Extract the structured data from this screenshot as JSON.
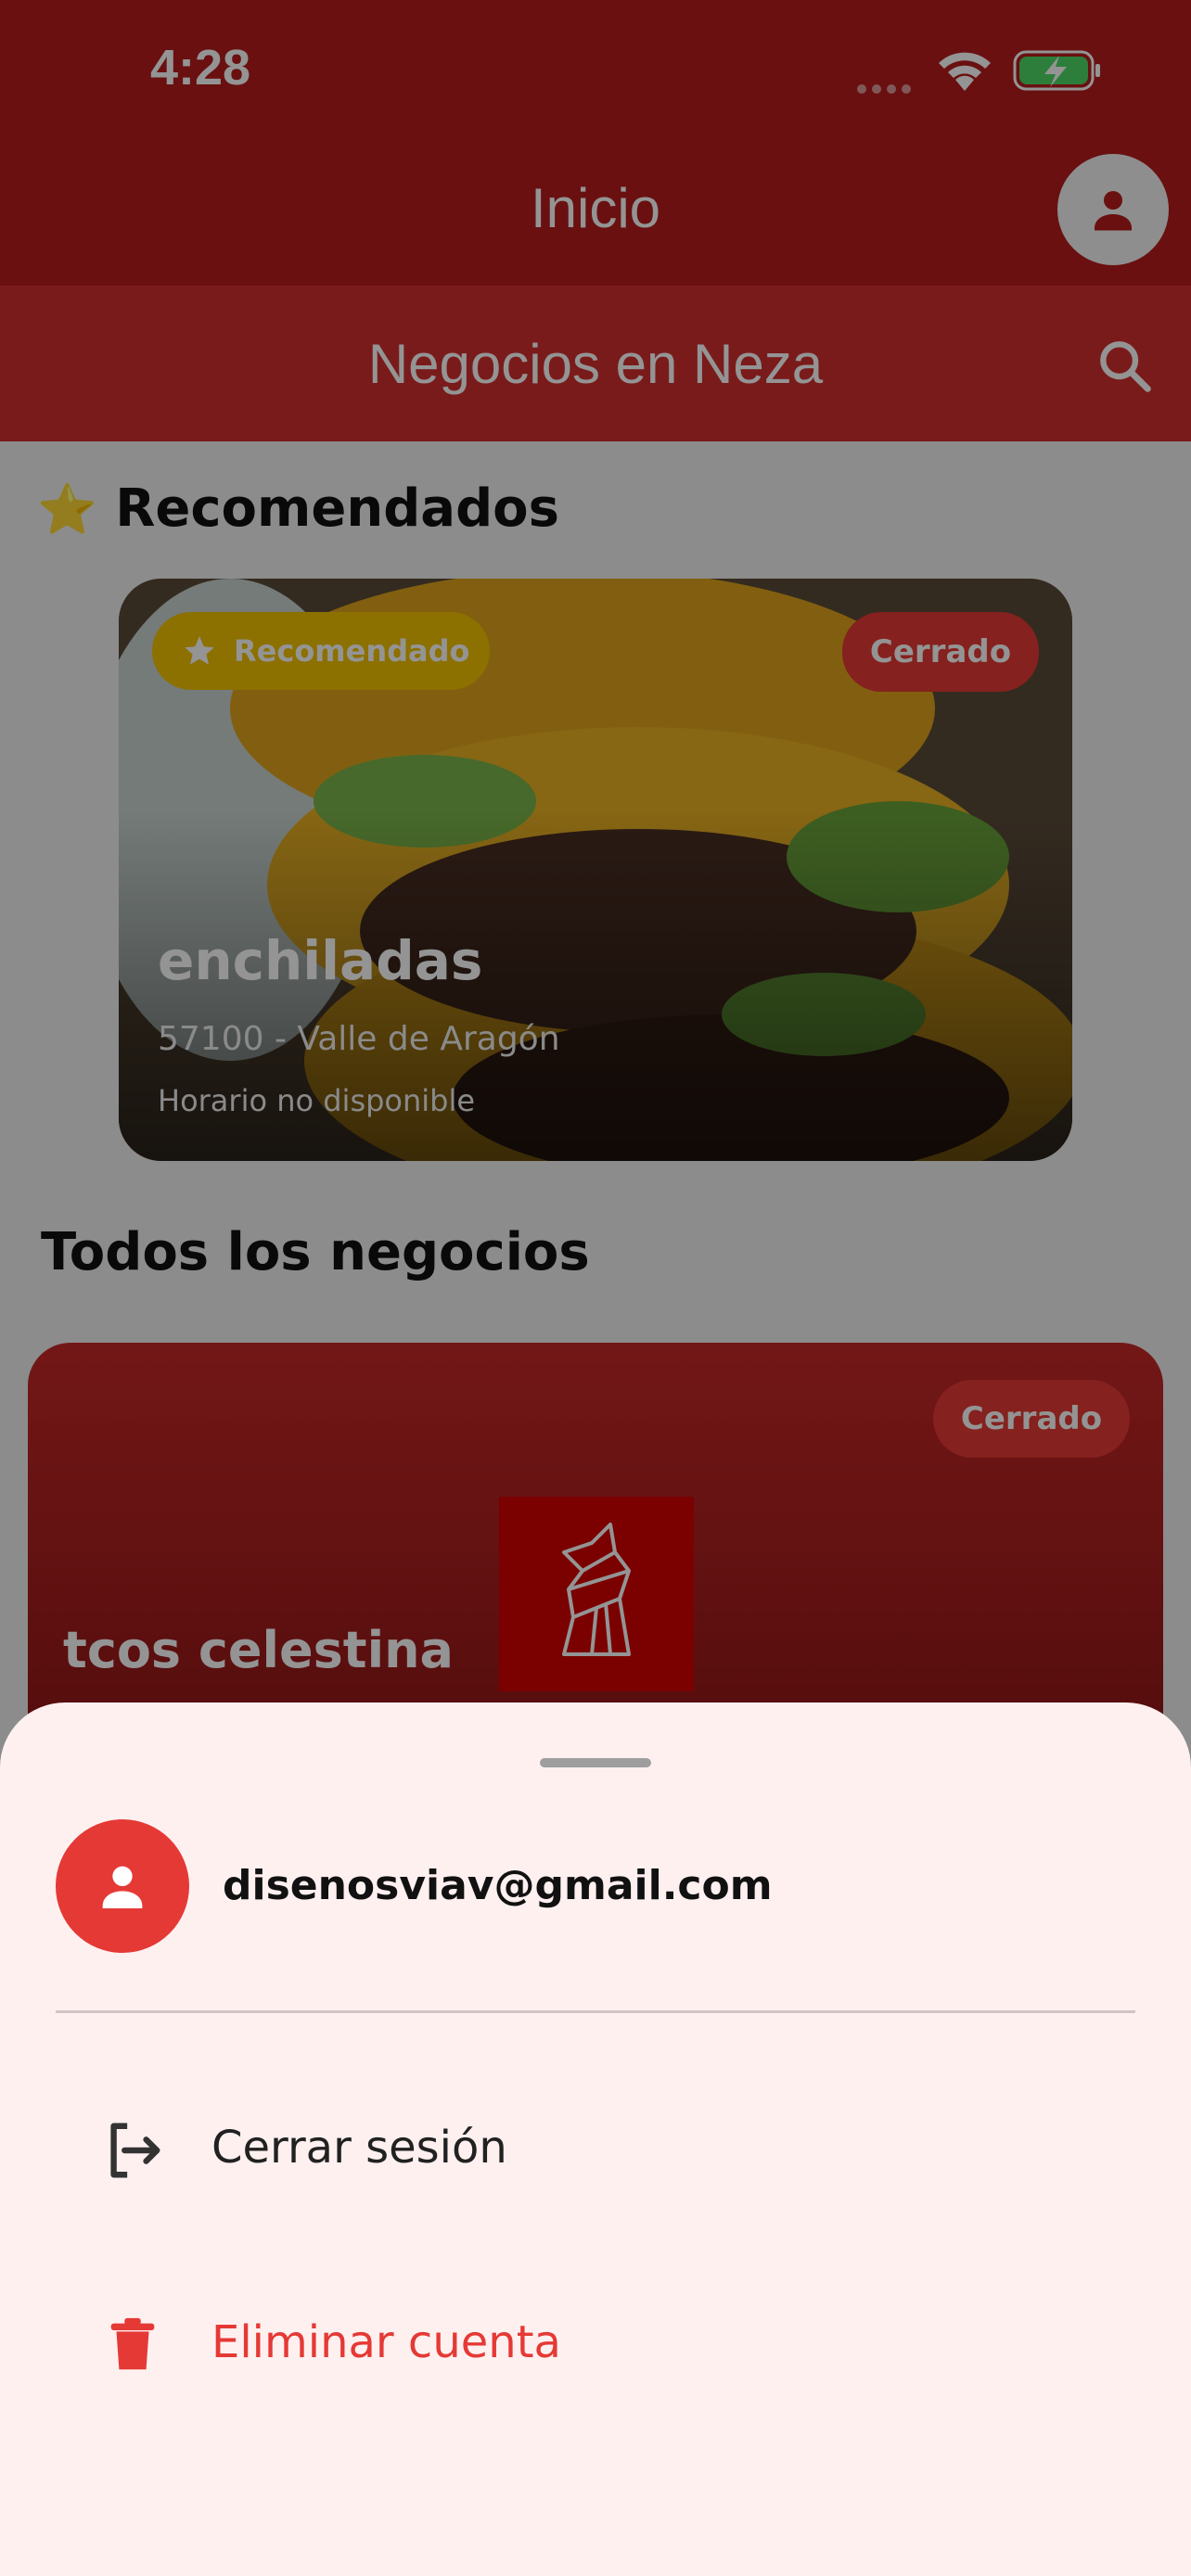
{
  "status_bar": {
    "time": "4:28"
  },
  "app_bar": {
    "title": "Inicio"
  },
  "sub_bar": {
    "title": "Negocios en Neza"
  },
  "recommended": {
    "star_glyph": "⭐",
    "title": "Recomendados",
    "card": {
      "badge": "Recomendado",
      "status": "Cerrado",
      "name": "enchiladas",
      "address": "57100 - Valle de Aragón",
      "hours": "Horario no disponible"
    }
  },
  "all_businesses": {
    "title": "Todos los negocios",
    "card": {
      "status": "Cerrado",
      "name": "tcos celestina"
    }
  },
  "sheet": {
    "email": "disenosviav@gmail.com",
    "items": [
      {
        "label": "Cerrar sesión",
        "icon": "logout-icon",
        "color": "#212121"
      },
      {
        "label": "Eliminar cuenta",
        "icon": "trash-icon",
        "color": "#e53935"
      }
    ]
  },
  "colors": {
    "primary": "#b71c1c",
    "accent": "#e53935",
    "gold": "#f2c200",
    "sheet_bg": "#fff0f0"
  }
}
